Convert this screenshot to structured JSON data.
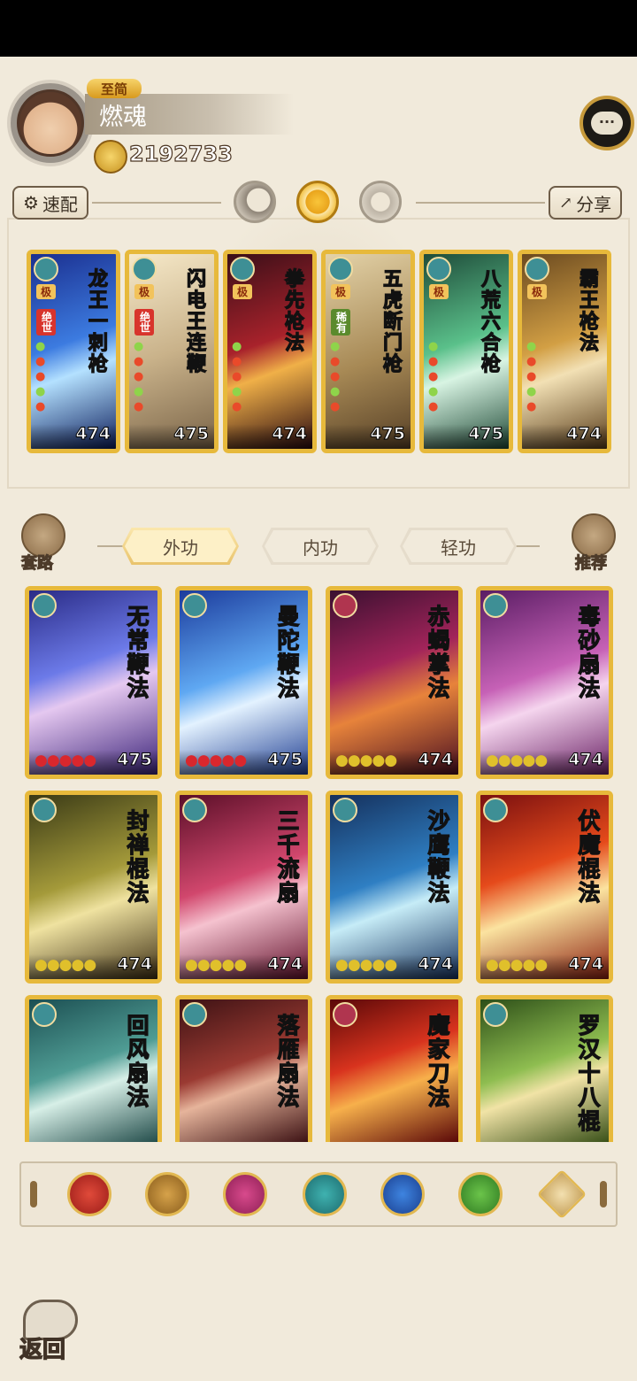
{
  "player": {
    "rank_label": "至简",
    "name": "燃魂",
    "power": "2192733"
  },
  "toolbar": {
    "quick_label": "速配",
    "share_label": "分享"
  },
  "equipped": [
    {
      "title": "龙王一刺枪",
      "badges": [
        "极",
        "绝世"
      ],
      "value": "474",
      "art": "blue"
    },
    {
      "title": "闪电王连鞭",
      "badges": [
        "极",
        "绝世"
      ],
      "value": "475",
      "art": "light"
    },
    {
      "title": "拳先枪法",
      "badges": [
        "极"
      ],
      "value": "474",
      "art": "red"
    },
    {
      "title": "五虎断门枪",
      "badges": [
        "极",
        "稀有"
      ],
      "value": "475",
      "art": "tan"
    },
    {
      "title": "八荒六合枪",
      "badges": [
        "极"
      ],
      "value": "475",
      "art": "green"
    },
    {
      "title": "霸王枪法",
      "badges": [
        "极"
      ],
      "value": "474",
      "art": "gold"
    }
  ],
  "tabs": {
    "left_label": "套路",
    "right_label": "推荐",
    "items": [
      "外功",
      "内功",
      "轻功"
    ],
    "active": "外功"
  },
  "skills": [
    {
      "title": "无常鞭法",
      "value": "475",
      "art": "violet"
    },
    {
      "title": "曼陀鞭法",
      "value": "475",
      "art": "skyblue"
    },
    {
      "title": "赤蝎掌法",
      "value": "474",
      "art": "crimson"
    },
    {
      "title": "毒砂扇法",
      "value": "474",
      "art": "pink"
    },
    {
      "title": "封禅棍法",
      "value": "474",
      "art": "olive"
    },
    {
      "title": "三千流扇",
      "value": "474",
      "art": "rose"
    },
    {
      "title": "沙鹰鞭法",
      "value": "474",
      "art": "ice"
    },
    {
      "title": "伏魔棍法",
      "value": "474",
      "art": "fire"
    },
    {
      "title": "回风扇法",
      "value": "",
      "art": "teal"
    },
    {
      "title": "落雁扇法",
      "value": "",
      "art": "dusk"
    },
    {
      "title": "魔家刀法",
      "value": "",
      "art": "flame"
    },
    {
      "title": "罗汉十八棍",
      "value": "",
      "art": "jade"
    }
  ],
  "filters": [
    "blade-icon",
    "sword-icon",
    "fist-icon",
    "lotus-icon",
    "yin-yang-icon",
    "spiral-icon",
    "up-arrow-icon"
  ],
  "nav": {
    "back_label": "返回"
  },
  "colors": {
    "gold_frame": "#e7b93b",
    "background": "#f1eadb"
  }
}
